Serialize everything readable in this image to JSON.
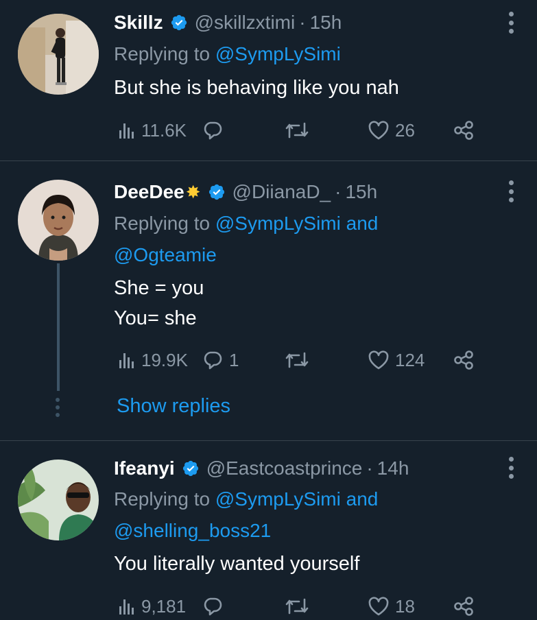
{
  "tweets": [
    {
      "name": "Skillz",
      "handle": "@skillzxtimi",
      "separator": "·",
      "time": "15h",
      "replying_prefix": "Replying to",
      "replying_line1": "@SympLySimi",
      "replying_line2": "",
      "text_lines": [
        "But she is behaving like you nah"
      ],
      "views": "11.6K",
      "replies": "",
      "likes": "26"
    },
    {
      "name": "DeeDee",
      "name_emoji": "🌟",
      "handle": "@DiianaD_",
      "separator": "·",
      "time": "15h",
      "replying_prefix": "Replying to",
      "replying_line1": "@SympLySimi and",
      "replying_line2": "@Ogteamie",
      "text_lines": [
        "She = you",
        "You= she"
      ],
      "views": "19.9K",
      "replies": "1",
      "likes": "124",
      "show_replies": "Show replies"
    },
    {
      "name": "Ifeanyi",
      "handle": "@Eastcoastprince",
      "separator": "·",
      "time": "14h",
      "replying_prefix": "Replying to",
      "replying_line1": "@SympLySimi and",
      "replying_line2": "@shelling_boss21",
      "text_lines": [
        "You literally wanted yourself"
      ],
      "views": "9,181",
      "replies": "",
      "likes": "18"
    }
  ],
  "colors": {
    "background": "#15202b",
    "link": "#1d9bf0",
    "muted": "#8b98a5",
    "divider": "#38444d"
  },
  "icons": [
    "verified-badge-icon",
    "more-options-icon",
    "views-icon",
    "reply-icon",
    "retweet-icon",
    "like-icon",
    "share-icon"
  ]
}
